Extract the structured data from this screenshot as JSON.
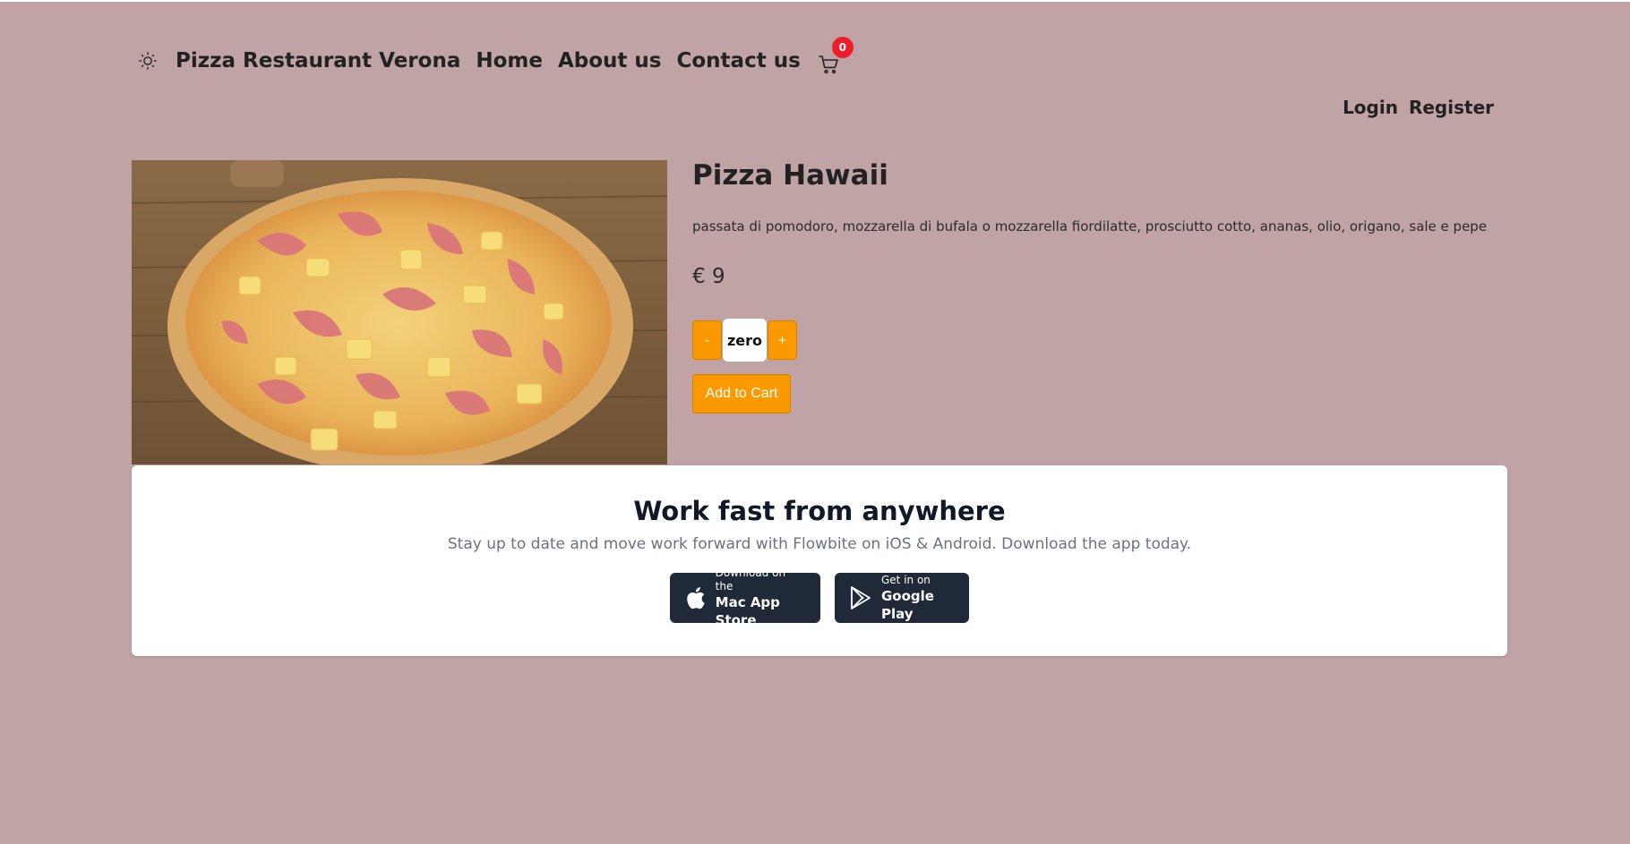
{
  "nav": {
    "theme_icon": "sun-icon",
    "brand": "Pizza Restaurant Verona",
    "links": [
      "Home",
      "About us",
      "Contact us"
    ],
    "cart_icon": "cart-icon",
    "cart_count": "0"
  },
  "auth": {
    "login": "Login",
    "register": "Register"
  },
  "product": {
    "image_icon": "pizza-photo",
    "title": "Pizza Hawaii",
    "description": "passata di pomodoro, mozzarella di bufala o mozzarella fiordilatte, prosciutto cotto, ananas, olio, origano, sale e pepe",
    "price": "€ 9",
    "qty_minus": "-",
    "qty_value": "zero",
    "qty_plus": "+",
    "add_to_cart": "Add to Cart",
    "accent_color": "#fb9a00"
  },
  "app_banner": {
    "title": "Work fast from anywhere",
    "subtitle": "Stay up to date and move work forward with Flowbite on iOS & Android. Download the app today.",
    "apple": {
      "icon": "apple-icon",
      "small": "Download on the",
      "big": "Mac App Store"
    },
    "google": {
      "icon": "google-play-icon",
      "small": "Get in on",
      "big": "Google Play"
    }
  }
}
